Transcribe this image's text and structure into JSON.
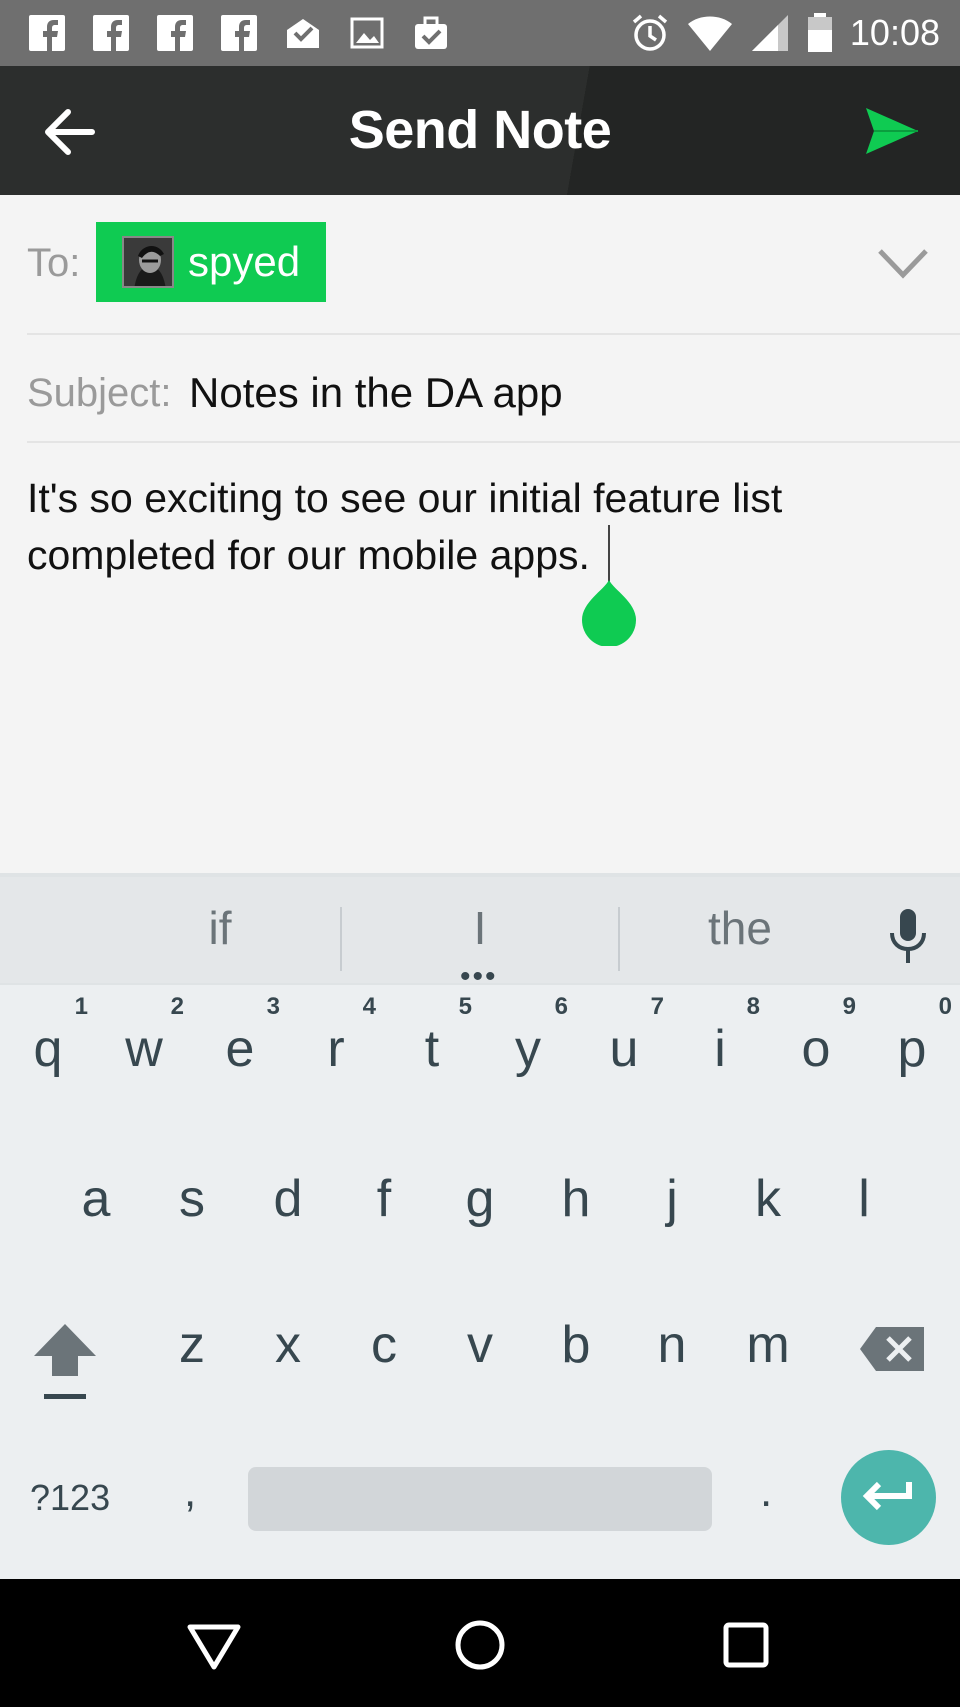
{
  "status_bar": {
    "time": "10:08",
    "left_icons": [
      "facebook-icon",
      "facebook-icon",
      "facebook-icon",
      "facebook-icon",
      "mail-check-icon",
      "image-icon",
      "briefcase-check-icon"
    ],
    "right_icons": [
      "alarm-icon",
      "wifi-icon",
      "signal-icon",
      "battery-icon"
    ]
  },
  "app_bar": {
    "title": "Send Note",
    "back_icon": "arrow-left-icon",
    "send_icon": "send-icon",
    "accent": "#0fcb52"
  },
  "compose": {
    "to_label": "To:",
    "recipient": {
      "name": "spyed",
      "avatar_icon": "avatar-icon"
    },
    "expand_icon": "chevron-down-icon",
    "subject_label": "Subject:",
    "subject_value": "Notes in the DA app",
    "body_line1": "It's so exciting to see our initial feature list",
    "body_line2": "completed for our mobile apps."
  },
  "keyboard": {
    "suggestions": [
      "if",
      "I",
      "the"
    ],
    "suggestion_more": "•••",
    "row1": [
      {
        "ch": "q",
        "hint": "1"
      },
      {
        "ch": "w",
        "hint": "2"
      },
      {
        "ch": "e",
        "hint": "3"
      },
      {
        "ch": "r",
        "hint": "4"
      },
      {
        "ch": "t",
        "hint": "5"
      },
      {
        "ch": "y",
        "hint": "6"
      },
      {
        "ch": "u",
        "hint": "7"
      },
      {
        "ch": "i",
        "hint": "8"
      },
      {
        "ch": "o",
        "hint": "9"
      },
      {
        "ch": "p",
        "hint": "0"
      }
    ],
    "row2": [
      "a",
      "s",
      "d",
      "f",
      "g",
      "h",
      "j",
      "k",
      "l"
    ],
    "row3": [
      "z",
      "x",
      "c",
      "v",
      "b",
      "n",
      "m"
    ],
    "symbols_label": "?123",
    "comma_label": ",",
    "period_label": ".",
    "enter_color": "#4db6ac"
  },
  "nav_bar": {
    "icons": [
      "back-triangle-icon",
      "home-circle-icon",
      "recents-square-icon"
    ]
  }
}
